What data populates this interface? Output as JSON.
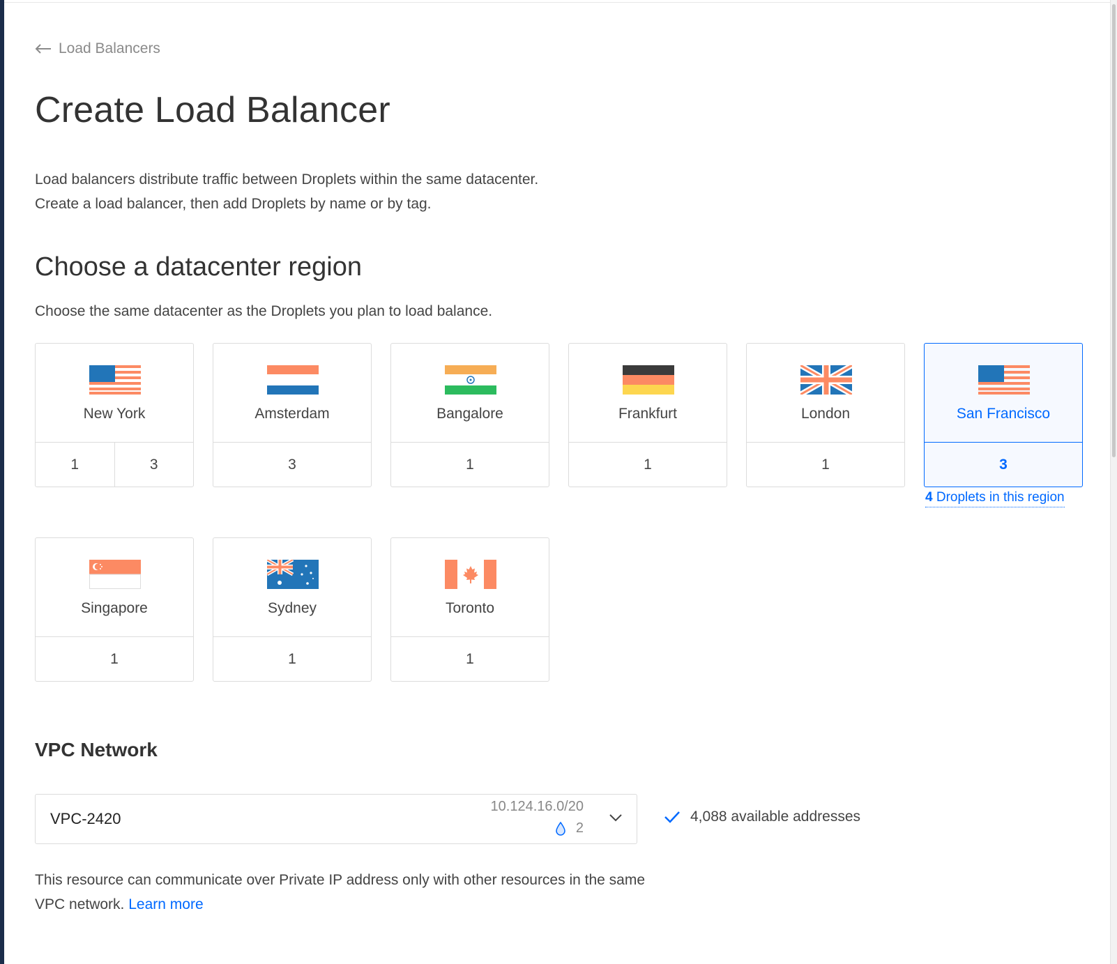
{
  "nav": {
    "back_label": "Load Balancers",
    "back_icon": "arrow-left-icon"
  },
  "page": {
    "title": "Create Load Balancer"
  },
  "intro": {
    "line1": "Load balancers distribute traffic between Droplets within the same datacenter.",
    "line2": "Create a load balancer, then add Droplets by name or by tag."
  },
  "region_section": {
    "title": "Choose a datacenter region",
    "subtitle": "Choose the same datacenter as the Droplets you plan to load balance.",
    "selected": "San Francisco",
    "droplets_count": "4",
    "droplets_text": " Droplets in this region",
    "regions": [
      {
        "name": "New York",
        "flag": "us-flag-icon",
        "datacenters": [
          "1",
          "3"
        ]
      },
      {
        "name": "Amsterdam",
        "flag": "netherlands-flag-icon",
        "datacenters": [
          "3"
        ]
      },
      {
        "name": "Bangalore",
        "flag": "india-flag-icon",
        "datacenters": [
          "1"
        ]
      },
      {
        "name": "Frankfurt",
        "flag": "germany-flag-icon",
        "datacenters": [
          "1"
        ]
      },
      {
        "name": "London",
        "flag": "uk-flag-icon",
        "datacenters": [
          "1"
        ]
      },
      {
        "name": "San Francisco",
        "flag": "us-flag-icon",
        "datacenters": [
          "3"
        ]
      },
      {
        "name": "Singapore",
        "flag": "singapore-flag-icon",
        "datacenters": [
          "1"
        ]
      },
      {
        "name": "Sydney",
        "flag": "australia-flag-icon",
        "datacenters": [
          "1"
        ]
      },
      {
        "name": "Toronto",
        "flag": "canada-flag-icon",
        "datacenters": [
          "1"
        ]
      }
    ]
  },
  "vpc": {
    "title": "VPC Network",
    "selected_name": "VPC-2420",
    "cidr": "10.124.16.0/20",
    "resource_count": "2",
    "available": "4,088 available addresses",
    "note": "This resource can communicate over Private IP address only with other resources in the same VPC network.",
    "learn_more": "Learn more"
  },
  "colors": {
    "accent": "#0069ff",
    "flag_blue": "#2275b8",
    "flag_red": "#fc8a63",
    "flag_green": "#2cbb5e",
    "flag_saffron": "#f6ad55",
    "flag_black": "#3b3b3b",
    "flag_yellow": "#fdd64f"
  }
}
